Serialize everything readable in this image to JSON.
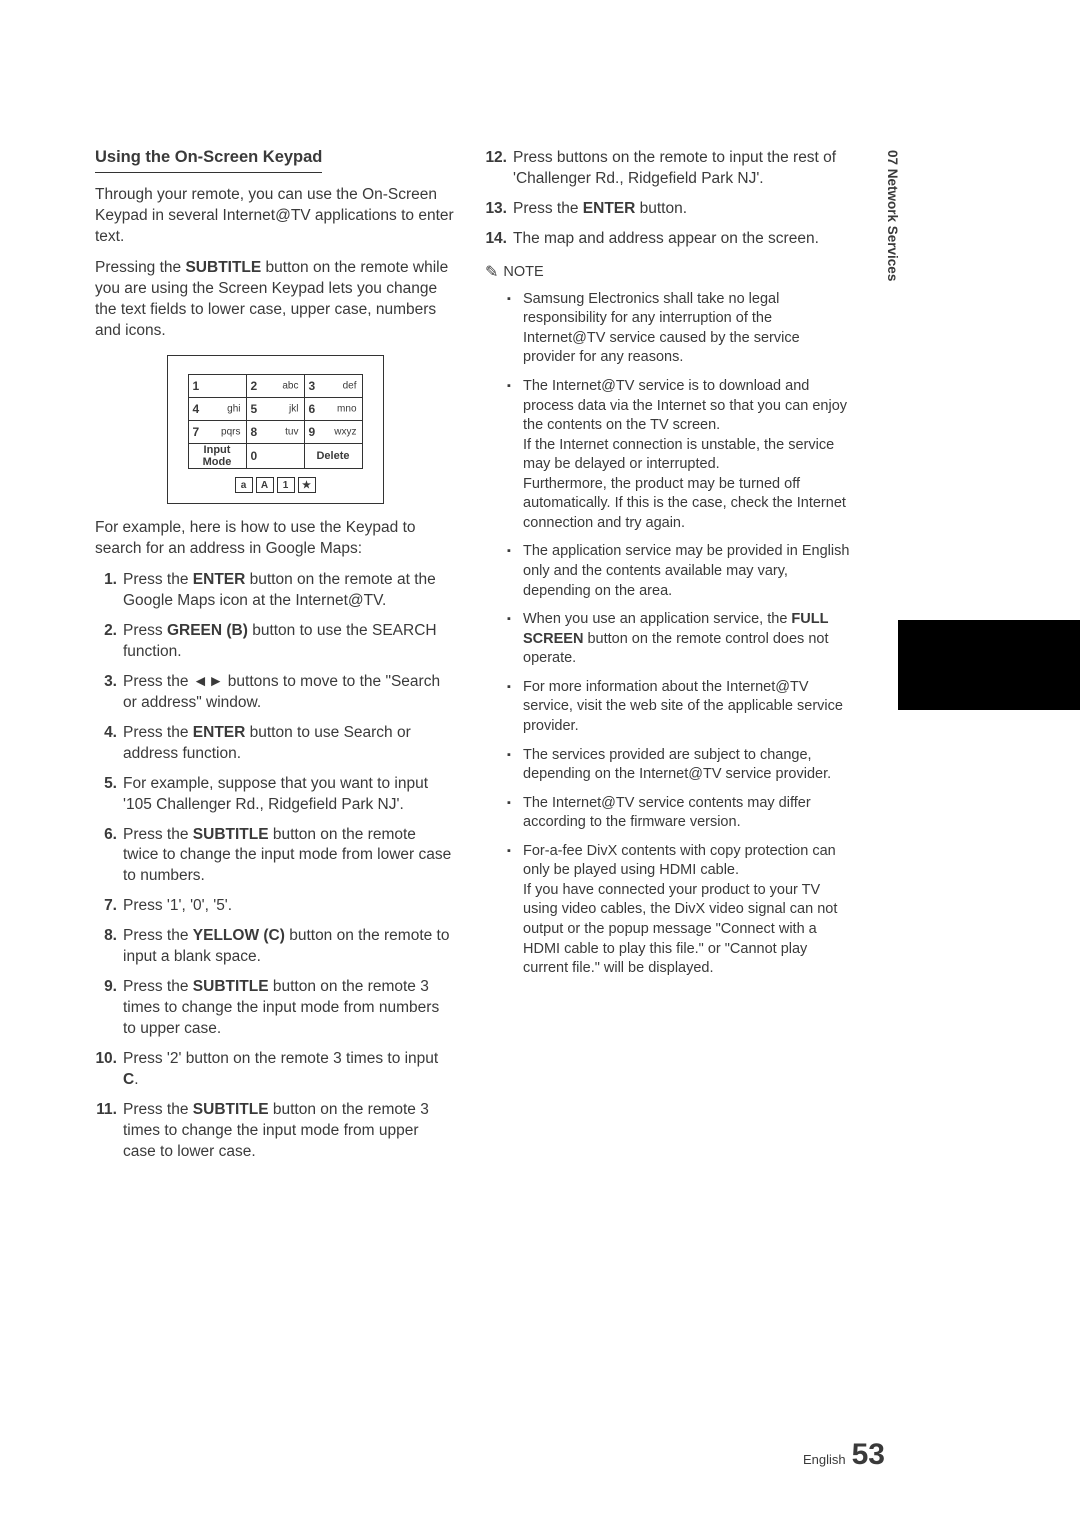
{
  "sideTab": "07   Network Services",
  "footer": {
    "label": "English",
    "page": "53"
  },
  "left": {
    "heading": "Using the On-Screen Keypad",
    "para1": "Through your remote, you can use the On-Screen Keypad in several Internet@TV applications to enter text.",
    "para2_part1": "Pressing the ",
    "para2_bold": "SUBTITLE",
    "para2_part2": " button on the remote while you are using the Screen Keypad lets you change the text fields to lower case, upper case, numbers and icons.",
    "keypad": {
      "rows": [
        [
          {
            "n": "1",
            "l": ""
          },
          {
            "n": "2",
            "l": "abc"
          },
          {
            "n": "3",
            "l": "def"
          }
        ],
        [
          {
            "n": "4",
            "l": "ghi"
          },
          {
            "n": "5",
            "l": "jkl"
          },
          {
            "n": "6",
            "l": "mno"
          }
        ],
        [
          {
            "n": "7",
            "l": "pqrs"
          },
          {
            "n": "8",
            "l": "tuv"
          },
          {
            "n": "9",
            "l": "wxyz"
          }
        ]
      ],
      "bottomRow": {
        "inputMode": "Input Mode",
        "zero": "0",
        "delete": "Delete"
      },
      "modes": [
        "a",
        "A",
        "1",
        "★"
      ]
    },
    "para3": "For example, here is how to use the Keypad to search for an address in Google Maps:",
    "steps": [
      {
        "n": "1.",
        "parts": [
          {
            "t": "Press the "
          },
          {
            "t": "ENTER",
            "b": true
          },
          {
            "t": " button on the remote at the Google Maps icon at the Internet@TV."
          }
        ]
      },
      {
        "n": "2.",
        "parts": [
          {
            "t": "Press "
          },
          {
            "t": "GREEN (B)",
            "b": true
          },
          {
            "t": " button to use the SEARCH function."
          }
        ]
      },
      {
        "n": "3.",
        "parts": [
          {
            "t": "Press the ◄► buttons to move to the \"Search or address\" window."
          }
        ]
      },
      {
        "n": "4.",
        "parts": [
          {
            "t": "Press the "
          },
          {
            "t": "ENTER",
            "b": true
          },
          {
            "t": " button to use Search or address function."
          }
        ]
      },
      {
        "n": "5.",
        "parts": [
          {
            "t": "For example, suppose that you want to input '105 Challenger Rd., Ridgefield Park NJ'."
          }
        ]
      },
      {
        "n": "6.",
        "parts": [
          {
            "t": "Press the "
          },
          {
            "t": "SUBTITLE",
            "b": true
          },
          {
            "t": " button on the remote twice to change the input mode from lower case to numbers."
          }
        ]
      },
      {
        "n": "7.",
        "parts": [
          {
            "t": "Press '1', '0', '5'."
          }
        ]
      },
      {
        "n": "8.",
        "parts": [
          {
            "t": "Press the "
          },
          {
            "t": "YELLOW (C)",
            "b": true
          },
          {
            "t": " button on the remote to input a blank space."
          }
        ]
      },
      {
        "n": "9.",
        "parts": [
          {
            "t": "Press the "
          },
          {
            "t": "SUBTITLE",
            "b": true
          },
          {
            "t": " button on the remote 3 times to change the input mode from numbers to upper case."
          }
        ]
      },
      {
        "n": "10.",
        "parts": [
          {
            "t": "Press '2' button on the remote 3 times to input "
          },
          {
            "t": "C",
            "b": true
          },
          {
            "t": "."
          }
        ]
      },
      {
        "n": "11.",
        "parts": [
          {
            "t": "Press the "
          },
          {
            "t": "SUBTITLE",
            "b": true
          },
          {
            "t": " button on the remote 3 times to change the input mode from upper case to lower case."
          }
        ]
      }
    ]
  },
  "right": {
    "stepsCont": [
      {
        "n": "12.",
        "parts": [
          {
            "t": "Press buttons on the remote to input the rest of 'Challenger Rd., Ridgefield Park NJ'."
          }
        ]
      },
      {
        "n": "13.",
        "parts": [
          {
            "t": "Press the "
          },
          {
            "t": "ENTER",
            "b": true
          },
          {
            "t": " button."
          }
        ]
      },
      {
        "n": "14.",
        "parts": [
          {
            "t": "The map and address appear on the screen."
          }
        ]
      }
    ],
    "noteLabel": "NOTE",
    "bullets": [
      {
        "parts": [
          {
            "t": "Samsung Electronics shall take no legal responsibility for any interruption of the Internet@TV service caused by the service provider for any reasons."
          }
        ]
      },
      {
        "parts": [
          {
            "t": "The Internet@TV service is to download and process data via the Internet so that you can enjoy the contents on the TV screen."
          },
          {
            "br": true
          },
          {
            "t": "If the Internet connection is unstable, the service may be delayed or interrupted."
          },
          {
            "br": true
          },
          {
            "t": "Furthermore, the product may be turned off automatically. If this is the case, check the Internet connection and try again."
          }
        ]
      },
      {
        "parts": [
          {
            "t": "The application service may be provided in English only and the contents available may vary, depending on the area."
          }
        ]
      },
      {
        "parts": [
          {
            "t": "When you use an application service, the "
          },
          {
            "t": "FULL SCREEN",
            "b": true
          },
          {
            "t": " button on the remote control does not operate."
          }
        ]
      },
      {
        "parts": [
          {
            "t": "For more information about the Internet@TV service, visit the web site of the applicable service provider."
          }
        ]
      },
      {
        "parts": [
          {
            "t": "The services provided are subject to change, depending on the Internet@TV service provider."
          }
        ]
      },
      {
        "parts": [
          {
            "t": "The Internet@TV service contents may differ according to the firmware version."
          }
        ]
      },
      {
        "parts": [
          {
            "t": "For-a-fee DivX contents with copy protection can only be played using HDMI cable."
          },
          {
            "br": true
          },
          {
            "t": "If you have connected your product to your TV using video cables, the DivX video signal can not output or the popup message \"Connect with a HDMI cable to play this file.\" or \"Cannot play current file.\" will be displayed."
          }
        ]
      }
    ]
  }
}
